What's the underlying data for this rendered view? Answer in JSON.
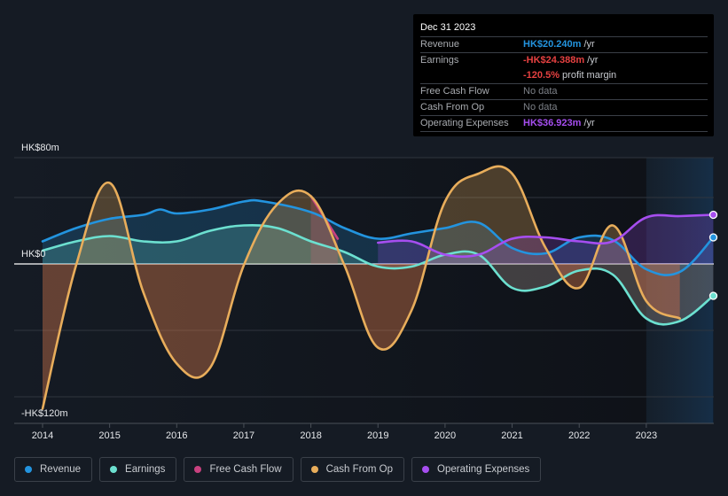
{
  "tooltip": {
    "date": "Dec 31 2023",
    "rows": [
      {
        "label": "Revenue",
        "value": "HK$20.240m",
        "suffix": " /yr",
        "color": "#2394df"
      },
      {
        "label": "Earnings",
        "value": "-HK$24.388m",
        "suffix": " /yr",
        "color": "#e64141"
      },
      {
        "label": "",
        "value": "-120.5%",
        "suffix": " profit margin",
        "color": "#e64141"
      },
      {
        "label": "Free Cash Flow",
        "value": "",
        "suffix": "No data",
        "color": "#a9acb1"
      },
      {
        "label": "Cash From Op",
        "value": "",
        "suffix": "No data",
        "color": "#a9acb1"
      },
      {
        "label": "Operating Expenses",
        "value": "HK$36.923m",
        "suffix": " /yr",
        "color": "#a64ef0"
      }
    ]
  },
  "legend": [
    {
      "label": "Revenue",
      "color": "#2394df"
    },
    {
      "label": "Earnings",
      "color": "#6ce0d0"
    },
    {
      "label": "Free Cash Flow",
      "color": "#c8417f"
    },
    {
      "label": "Cash From Op",
      "color": "#e8ad5b"
    },
    {
      "label": "Operating Expenses",
      "color": "#a64ef0"
    }
  ],
  "chart_data": {
    "type": "line",
    "title": "",
    "xlabel": "",
    "ylabel": "",
    "currency_unit": "HK$ m",
    "ylim": [
      -120,
      80
    ],
    "xlim": [
      2014,
      2024
    ],
    "y_tick_labels": [
      {
        "value": 80,
        "label": "HK$80m"
      },
      {
        "value": 0,
        "label": "HK$0"
      },
      {
        "value": -120,
        "label": "-HK$120m"
      }
    ],
    "y_gridlines": [
      80,
      50,
      0,
      -50,
      -100
    ],
    "x_ticks": [
      2014,
      2015,
      2016,
      2017,
      2018,
      2019,
      2020,
      2021,
      2022,
      2023
    ],
    "highlight_region": [
      2023,
      2024
    ],
    "grid": true,
    "legend_position": "bottom",
    "series": [
      {
        "name": "Revenue",
        "color": "#2394df",
        "x": [
          2014,
          2014.5,
          2015,
          2015.5,
          2015.75,
          2016,
          2016.5,
          2017,
          2017.3,
          2018,
          2018.5,
          2019,
          2019.5,
          2020,
          2020.5,
          2021,
          2021.5,
          2022,
          2022.5,
          2023,
          2023.5,
          2024
        ],
        "y": [
          17,
          27,
          34,
          37,
          41,
          38,
          41,
          47,
          47,
          39,
          27,
          19,
          23,
          27,
          31,
          12,
          8,
          20,
          18,
          -4,
          -6,
          20
        ]
      },
      {
        "name": "Earnings",
        "color": "#6ce0d0",
        "x": [
          2014,
          2014.5,
          2015,
          2015.5,
          2016,
          2016.5,
          2017,
          2017.5,
          2018,
          2018.5,
          2019,
          2019.5,
          2020,
          2020.5,
          2021,
          2021.5,
          2022,
          2022.5,
          2023,
          2023.5,
          2024
        ],
        "y": [
          10,
          17,
          21,
          17,
          17,
          25,
          29,
          27,
          17,
          9,
          -2,
          -2,
          7,
          7,
          -18,
          -17,
          -5,
          -8,
          -41,
          -43,
          -24
        ]
      },
      {
        "name": "Free Cash Flow",
        "color": "#c8417f",
        "x": [
          2018,
          2018.4
        ],
        "y": [
          51,
          19
        ]
      },
      {
        "name": "Cash From Op",
        "color": "#e8ad5b",
        "x": [
          2014,
          2014.5,
          2015,
          2015.5,
          2016,
          2016.5,
          2017,
          2017.5,
          2018,
          2018.5,
          2019,
          2019.5,
          2020,
          2020.5,
          2021,
          2021.5,
          2022,
          2022.5,
          2023,
          2023.5
        ],
        "y": [
          -109,
          -1,
          61,
          -21,
          -75,
          -78,
          -1,
          45,
          51,
          -1,
          -63,
          -35,
          47,
          68,
          68,
          12,
          -18,
          29,
          -28,
          -41
        ]
      },
      {
        "name": "Operating Expenses",
        "color": "#a64ef0",
        "x": [
          2019,
          2019.5,
          2020,
          2020.5,
          2021,
          2021.5,
          2022,
          2022.5,
          2023,
          2023.5,
          2024
        ],
        "y": [
          16,
          17,
          7,
          7,
          19,
          20,
          17,
          17,
          35,
          36,
          37
        ]
      }
    ]
  }
}
